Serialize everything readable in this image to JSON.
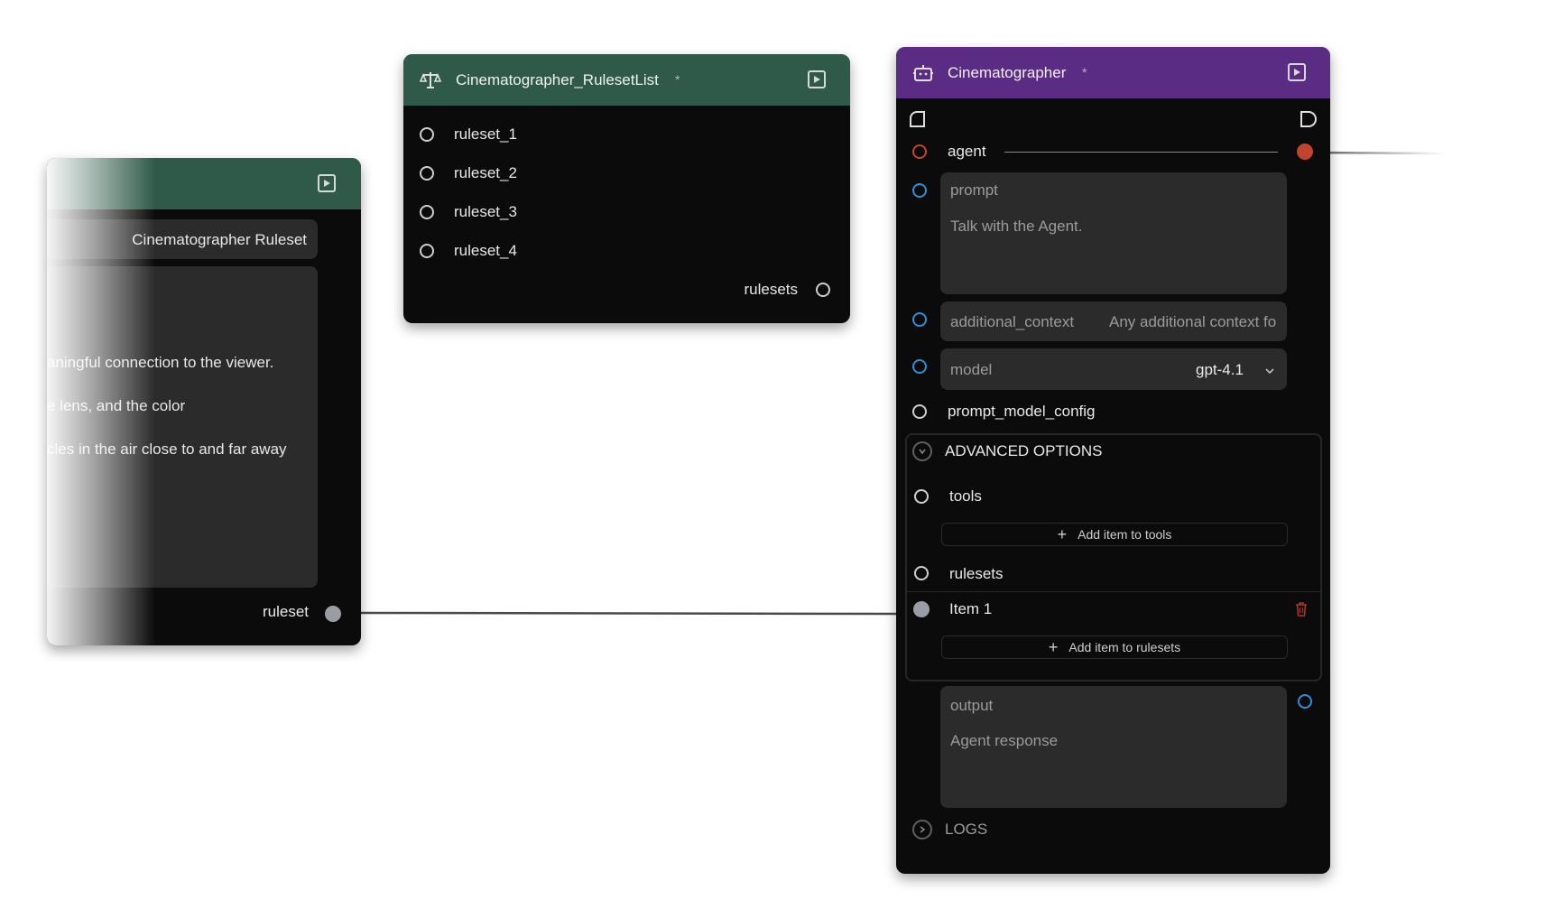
{
  "left_node": {
    "ruleset_name": "Cinematographer Ruleset",
    "rules_lines": [
      "aningful connection to the viewer.",
      "e lens, and the color",
      "cles in the air close to and far away"
    ],
    "output_label": "ruleset"
  },
  "ruleset_list_node": {
    "title": "Cinematographer_RulesetList",
    "modified_marker": "*",
    "inputs": [
      "ruleset_1",
      "ruleset_2",
      "ruleset_3",
      "ruleset_4"
    ],
    "output_label": "rulesets"
  },
  "agent_node": {
    "title": "Cinematographer",
    "modified_marker": "*",
    "agent_label": "agent",
    "prompt_label": "prompt",
    "prompt_placeholder": "Talk with the Agent.",
    "additional_context_label": "additional_context",
    "additional_context_placeholder": "Any additional context fo",
    "model_label": "model",
    "model_value": "gpt-4.1",
    "prompt_model_config_label": "prompt_model_config",
    "advanced_options_label": "ADVANCED OPTIONS",
    "tools_label": "tools",
    "add_tools_label": "Add item to tools",
    "rulesets_label": "rulesets",
    "rulesets_item_label": "Item 1",
    "add_rulesets_label": "Add item to rulesets",
    "output_label": "output",
    "output_placeholder": "Agent response",
    "logs_label": "LOGS"
  },
  "colors": {
    "green_header": "#2f5a4a",
    "purple_header": "#5b2c84",
    "agent_port": "#c1442c",
    "text_port": "#2f8fd8"
  }
}
